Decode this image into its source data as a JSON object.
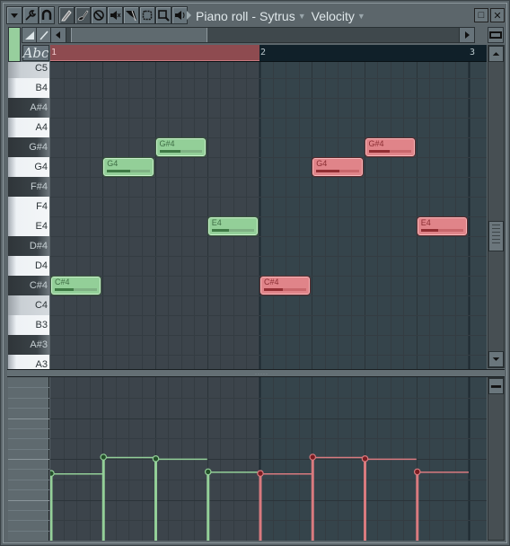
{
  "window": {
    "title": "Piano roll",
    "instrument": "Sytrus",
    "event_type": "Velocity",
    "maximize_label": "□",
    "close_label": "✕"
  },
  "toolbar": {
    "icons": [
      "dropdown-icon",
      "wrench-icon",
      "magnet-icon",
      "pencil-icon",
      "brush-icon",
      "delete-icon",
      "mute-icon",
      "slice-icon",
      "select-icon",
      "zoom-icon",
      "playback-icon"
    ]
  },
  "controls": {
    "abc_label": "Abc",
    "color_swatch": "#97cf9d"
  },
  "timeline": {
    "bars": [
      "1",
      "2",
      "3"
    ]
  },
  "keys": [
    "C5",
    "B4",
    "A#4",
    "A4",
    "G#4",
    "G4",
    "F#4",
    "F4",
    "E4",
    "D#4",
    "D4",
    "C#4",
    "C4",
    "B3",
    "A#3",
    "A3"
  ],
  "notes": [
    {
      "label": "C#4",
      "bar": 1,
      "beat_start": 0,
      "beats": 1,
      "color": "green",
      "velocity": 0.45
    },
    {
      "label": "G4",
      "bar": 1,
      "beat_start": 1,
      "beats": 1,
      "color": "green",
      "velocity": 0.55
    },
    {
      "label": "G#4",
      "bar": 1,
      "beat_start": 2,
      "beats": 1,
      "color": "green",
      "velocity": 0.5
    },
    {
      "label": "E4",
      "bar": 1,
      "beat_start": 3,
      "beats": 1,
      "color": "green",
      "velocity": 0.4
    },
    {
      "label": "C#4",
      "bar": 2,
      "beat_start": 0,
      "beats": 1,
      "color": "red",
      "velocity": 0.45
    },
    {
      "label": "G4",
      "bar": 2,
      "beat_start": 1,
      "beats": 1,
      "color": "red",
      "velocity": 0.55
    },
    {
      "label": "G#4",
      "bar": 2,
      "beat_start": 2,
      "beats": 1,
      "color": "red",
      "velocity": 0.5
    },
    {
      "label": "E4",
      "bar": 2,
      "beat_start": 3,
      "beats": 1,
      "color": "red",
      "velocity": 0.4
    }
  ],
  "velocity_lane": {
    "values": [
      0.4,
      0.5,
      0.49,
      0.41,
      0.4,
      0.5,
      0.49,
      0.41
    ]
  },
  "colors": {
    "green_note": "#93cf98",
    "red_note": "#e08489",
    "green_stem": "#93cf98",
    "red_stem": "#d97a7f"
  }
}
